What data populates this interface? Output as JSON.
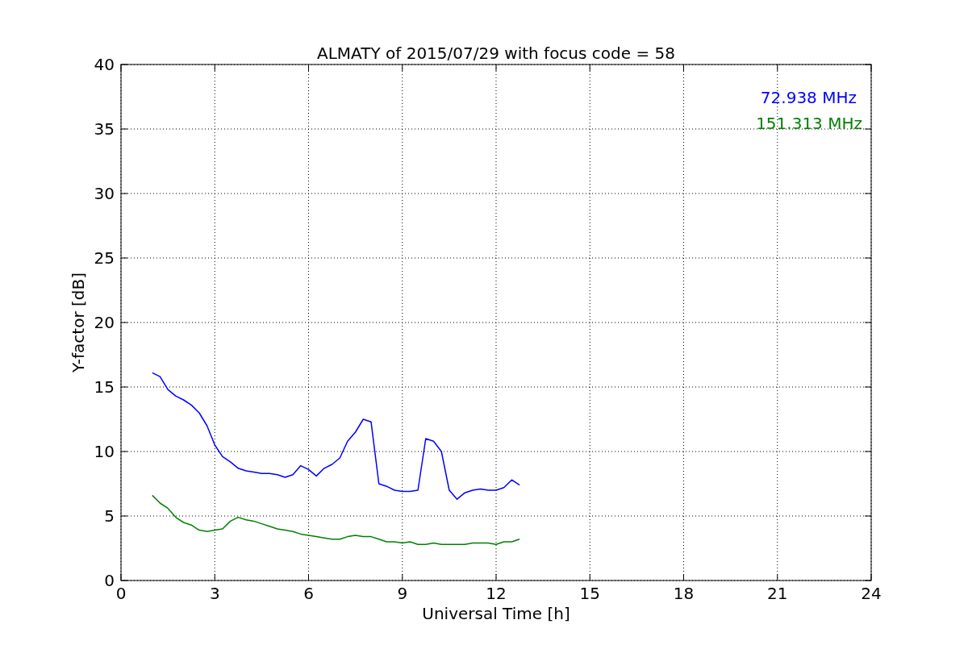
{
  "chart_data": {
    "type": "line",
    "title": "ALMATY of 2015/07/29 with focus code = 58",
    "xlabel": "Universal Time [h]",
    "ylabel": "Y-factor [dB]",
    "x": [
      1.0,
      1.25,
      1.5,
      1.75,
      2.0,
      2.25,
      2.5,
      2.75,
      3.0,
      3.25,
      3.5,
      3.75,
      4.0,
      4.25,
      4.5,
      4.75,
      5.0,
      5.25,
      5.5,
      5.75,
      6.0,
      6.25,
      6.5,
      6.75,
      7.0,
      7.25,
      7.5,
      7.75,
      8.0,
      8.25,
      8.5,
      8.75,
      9.0,
      9.25,
      9.5,
      9.75,
      10.0,
      10.25,
      10.5,
      10.75,
      11.0,
      11.25,
      11.5,
      11.75,
      12.0,
      12.25,
      12.5,
      12.75
    ],
    "series": [
      {
        "name": "72.938 MHz",
        "color": "#0000ff",
        "values": [
          16.1,
          15.8,
          14.8,
          14.3,
          14.0,
          13.6,
          13.0,
          12.0,
          10.5,
          9.6,
          9.2,
          8.7,
          8.5,
          8.4,
          8.3,
          8.3,
          8.2,
          8.0,
          8.2,
          8.9,
          8.6,
          8.1,
          8.7,
          9.0,
          9.5,
          10.8,
          11.5,
          12.5,
          12.3,
          7.5,
          7.3,
          7.0,
          6.9,
          6.9,
          7.0,
          11.0,
          10.8,
          10.0,
          7.0,
          6.3,
          6.8,
          7.0,
          7.1,
          7.0,
          7.0,
          7.2,
          7.8,
          7.4
        ]
      },
      {
        "name": "151.313 MHz",
        "color": "#008000",
        "values": [
          6.6,
          6.0,
          5.6,
          4.9,
          4.5,
          4.3,
          3.9,
          3.8,
          3.9,
          4.0,
          4.6,
          4.9,
          4.7,
          4.6,
          4.4,
          4.2,
          4.0,
          3.9,
          3.8,
          3.6,
          3.5,
          3.4,
          3.3,
          3.2,
          3.2,
          3.4,
          3.5,
          3.4,
          3.4,
          3.2,
          3.0,
          3.0,
          2.9,
          3.0,
          2.8,
          2.8,
          2.9,
          2.8,
          2.8,
          2.8,
          2.8,
          2.9,
          2.9,
          2.9,
          2.8,
          3.0,
          3.0,
          3.2
        ]
      }
    ],
    "grid": true,
    "xlim": [
      0,
      24
    ],
    "ylim": [
      0,
      40
    ],
    "xticks": [
      0,
      3,
      6,
      9,
      12,
      15,
      18,
      21,
      24
    ],
    "yticks": [
      0,
      5,
      10,
      15,
      20,
      25,
      30,
      35,
      40
    ]
  }
}
